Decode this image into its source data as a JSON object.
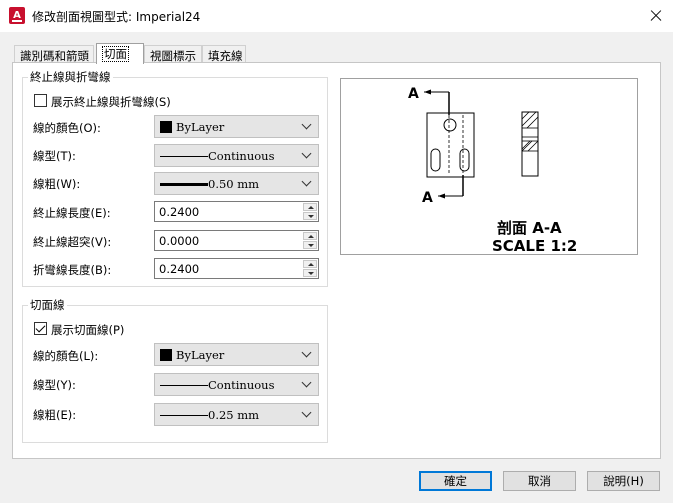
{
  "window": {
    "title": "修改剖面視圖型式: Imperial24"
  },
  "tabs": [
    {
      "label": "識別碼和箭頭"
    },
    {
      "label": "切面"
    },
    {
      "label": "視圖標示"
    },
    {
      "label": "填充線"
    }
  ],
  "end_lines": {
    "title": "終止線與折彎線",
    "show_label": "展示終止線與折彎線(S)",
    "show_checked": false,
    "color_label": "線的顏色(O):",
    "color_value": "ByLayer",
    "linetype_label": "線型(T):",
    "linetype_value": "Continuous",
    "lineweight_label": "線粗(W):",
    "lineweight_value": "0.50 mm",
    "end_length_label": "終止線長度(E):",
    "end_length_value": "0.2400",
    "overshoot_label": "終止線超突(V):",
    "overshoot_value": "0.0000",
    "bend_length_label": "折彎線長度(B):",
    "bend_length_value": "0.2400"
  },
  "cutting_plane": {
    "title": "切面線",
    "show_label": "展示切面線(P)",
    "show_checked": true,
    "color_label": "線的顏色(L):",
    "color_value": "ByLayer",
    "linetype_label": "線型(Y):",
    "linetype_value": "Continuous",
    "lineweight_label": "線粗(E):",
    "lineweight_value": "0.25 mm"
  },
  "preview": {
    "marker_top": "A",
    "marker_bottom": "A",
    "caption_line1": "剖面 A-A",
    "caption_line2": "SCALE 1:2"
  },
  "buttons": {
    "ok": "確定",
    "cancel": "取消",
    "help": "說明(H)"
  },
  "colors": {
    "accent": "#0078d7",
    "app_icon": "#c8102e"
  }
}
